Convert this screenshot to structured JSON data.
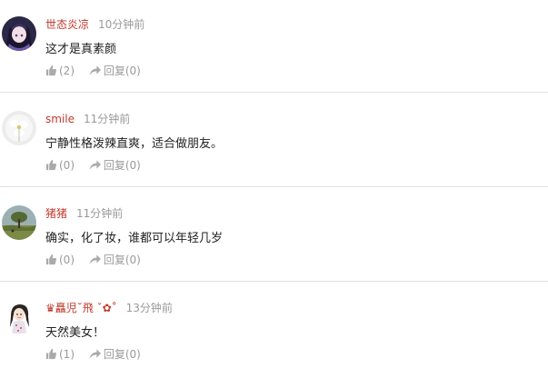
{
  "colors": {
    "username": "#c0392b",
    "timestamp": "#999999",
    "text": "#222222",
    "action": "#9a9a9a",
    "divider": "#e2e2e2"
  },
  "comments": [
    {
      "username": "世态炎凉",
      "time": "10分钟前",
      "text": "这才是真素颜",
      "like_count": "(2)",
      "reply_label": "回复(0)",
      "avatar_icon": "anime-girl-avatar-icon"
    },
    {
      "username": "smile",
      "time": "11分钟前",
      "text": "宁静性格泼辣直爽，适合做朋友。",
      "like_count": "(0)",
      "reply_label": "回复(0)",
      "avatar_icon": "white-flower-avatar-icon"
    },
    {
      "username": "猪猪",
      "time": "11分钟前",
      "text": "确实，化了妆，谁都可以年轻几岁",
      "like_count": "(0)",
      "reply_label": "回复(0)",
      "avatar_icon": "landscape-tree-avatar-icon"
    },
    {
      "username": "♛矗児˘飛 ˇ✿˚",
      "time": "13分钟前",
      "text": "天然美女！",
      "like_count": "(1)",
      "reply_label": "回复(0)",
      "avatar_icon": "cartoon-girl-avatar-icon"
    }
  ]
}
